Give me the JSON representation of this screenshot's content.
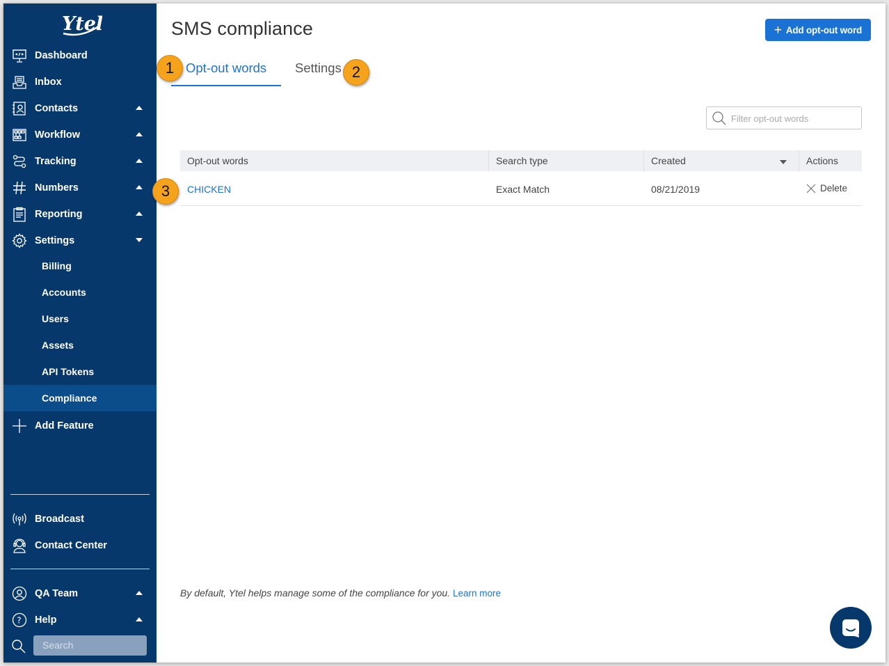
{
  "app": {
    "brand": "Ytel",
    "colors": {
      "sidebar": "#07386b",
      "accent": "#1a73d4",
      "active_item": "#0b4c8b",
      "badge": "#f5a21d"
    }
  },
  "sidebar": {
    "items": [
      {
        "label": "Dashboard",
        "icon": "dashboard-icon"
      },
      {
        "label": "Inbox",
        "icon": "inbox-icon"
      },
      {
        "label": "Contacts",
        "icon": "contacts-icon",
        "caret": "up"
      },
      {
        "label": "Workflow",
        "icon": "workflow-icon",
        "caret": "up"
      },
      {
        "label": "Tracking",
        "icon": "tracking-icon",
        "caret": "up"
      },
      {
        "label": "Numbers",
        "icon": "hash-icon",
        "caret": "up"
      },
      {
        "label": "Reporting",
        "icon": "reporting-icon",
        "caret": "up"
      },
      {
        "label": "Settings",
        "icon": "gear-icon",
        "caret": "down"
      }
    ],
    "settings_sub": [
      {
        "label": "Billing"
      },
      {
        "label": "Accounts"
      },
      {
        "label": "Users"
      },
      {
        "label": "Assets"
      },
      {
        "label": "API Tokens"
      },
      {
        "label": "Compliance",
        "active": true
      }
    ],
    "add_feature": "Add Feature",
    "bottom_items": [
      {
        "label": "Broadcast",
        "icon": "broadcast-icon"
      },
      {
        "label": "Contact Center",
        "icon": "headset-icon"
      }
    ],
    "team": {
      "label": "QA Team",
      "icon": "user-circle-icon",
      "caret": "up"
    },
    "help": {
      "label": "Help",
      "icon": "help-icon",
      "caret": "up"
    },
    "search_placeholder": "Search"
  },
  "header": {
    "title": "SMS compliance",
    "add_button": "Add opt-out word"
  },
  "tabs": [
    {
      "label": "Opt-out words",
      "active": true,
      "badge": "1"
    },
    {
      "label": "Settings",
      "active": false,
      "badge": "2"
    }
  ],
  "filter": {
    "placeholder": "Filter opt-out words"
  },
  "table": {
    "columns": [
      "Opt-out words",
      "Search type",
      "Created",
      "Actions"
    ],
    "rows": [
      {
        "word": "CHICKEN",
        "search_type": "Exact Match",
        "created": "08/21/2019",
        "action": "Delete",
        "badge": "3"
      }
    ]
  },
  "footer": {
    "note": "By default, Ytel helps manage some of the compliance for you.",
    "link": "Learn more"
  }
}
